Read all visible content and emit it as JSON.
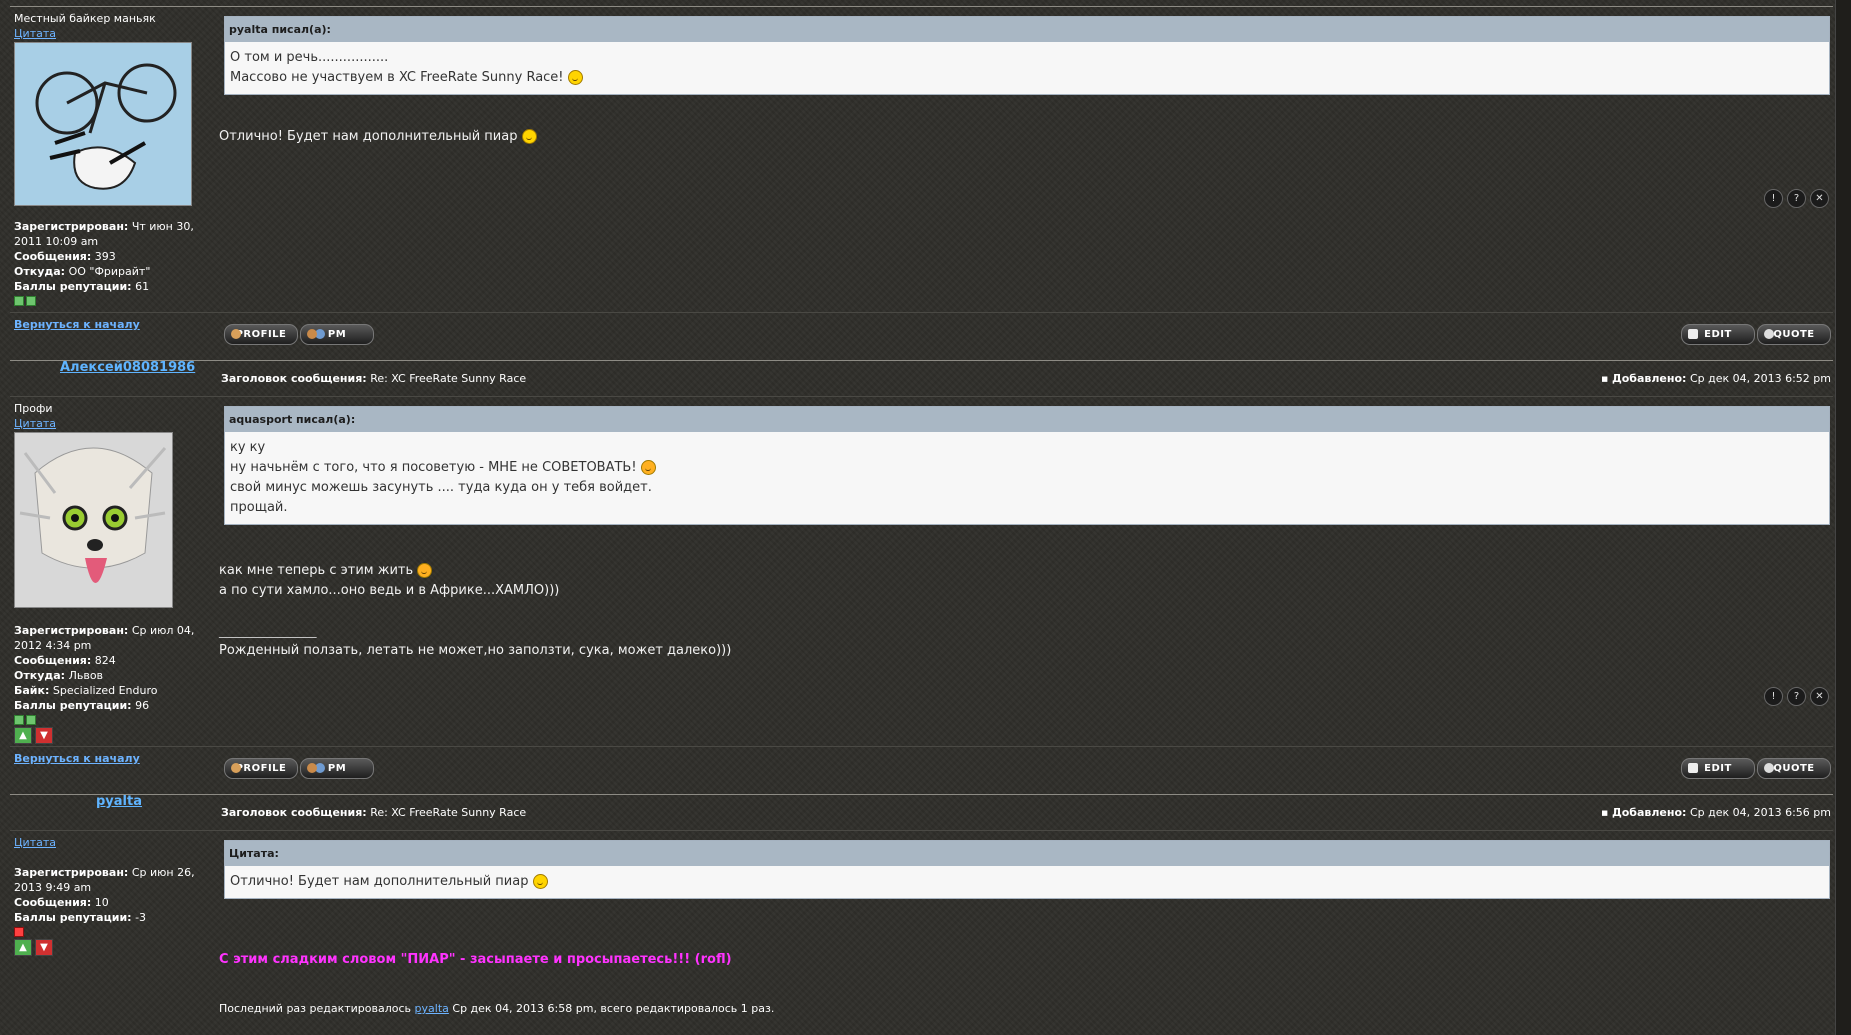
{
  "labels": {
    "registered": "Зарегистрирован:",
    "messages": "Сообщения:",
    "from": "Откуда:",
    "bike": "Байк:",
    "rep": "Баллы репутации:",
    "back_to_top": "Вернуться к началу",
    "subject": "Заголовок сообщения:",
    "added": "Добавлено:",
    "profile": "PROFILE",
    "pm": "PM",
    "edit": "EDIT",
    "quote": "QUOTE"
  },
  "post1": {
    "rank": "Местный байкер маньяк",
    "cite": "Цитата",
    "registered": "Чт июн 30, 2011 10:09 am",
    "messages": "393",
    "from": "ОО \"Фрирайт\"",
    "rep": "61",
    "quote_head": "pyalta писал(а):",
    "quote_line1": "О том и речь.................",
    "quote_line2": "Массово не участвуем в XC FreeRate Sunny Race!",
    "text": "Отлично! Будет нам дополнительный пиар"
  },
  "post2": {
    "author": "Алексей08081986",
    "subject": "Re: XC FreeRate Sunny Race",
    "added": "Ср дек 04, 2013 6:52 pm",
    "rank": "Профи",
    "cite": "Цитата",
    "registered": "Ср июл 04, 2012 4:34 pm",
    "messages": "824",
    "from": "Львов",
    "bike": "Specialized Enduro",
    "rep": "96",
    "quote_head": "aquasport писал(а):",
    "quote_line1": "ку ку",
    "quote_line2": "ну начьнём с того, что я посоветую - МНЕ не СОВЕТОВАТЬ!",
    "quote_line3": "свой минус можешь засунуть .... туда куда он у тебя войдет.",
    "quote_line4": "прощай.",
    "text_line1": "как мне теперь с этим жить",
    "text_line2": "а по сути хамло...оно ведь и в Африке...ХАМЛО)))",
    "signature_rule": "_______________",
    "signature": "Рожденный ползать, летать не может,но заползти, сука, может далеко)))"
  },
  "post3": {
    "author": "pyalta",
    "subject": "Re: XC FreeRate Sunny Race",
    "added": "Ср дек 04, 2013 6:56 pm",
    "cite": "Цитата",
    "registered": "Ср июн 26, 2013 9:49 am",
    "messages": "10",
    "rep": "-3",
    "quote_head": "Цитата:",
    "quote_line1": "Отлично! Будет нам дополнительный пиар",
    "pink_text": "С этим сладким словом \"ПИАР\" - засыпаете и просыпаетесь!!! (rofl)",
    "edit_prefix": "Последний раз редактировалось",
    "edit_user": "pyalta",
    "edit_suffix": "Ср дек 04, 2013 6:58 pm, всего редактировалось 1 раз."
  },
  "colors": {
    "background": "#2f2e2a",
    "link": "#6db3ff",
    "quote_head": "#a9b7c4",
    "pink": "#ff33ff"
  }
}
